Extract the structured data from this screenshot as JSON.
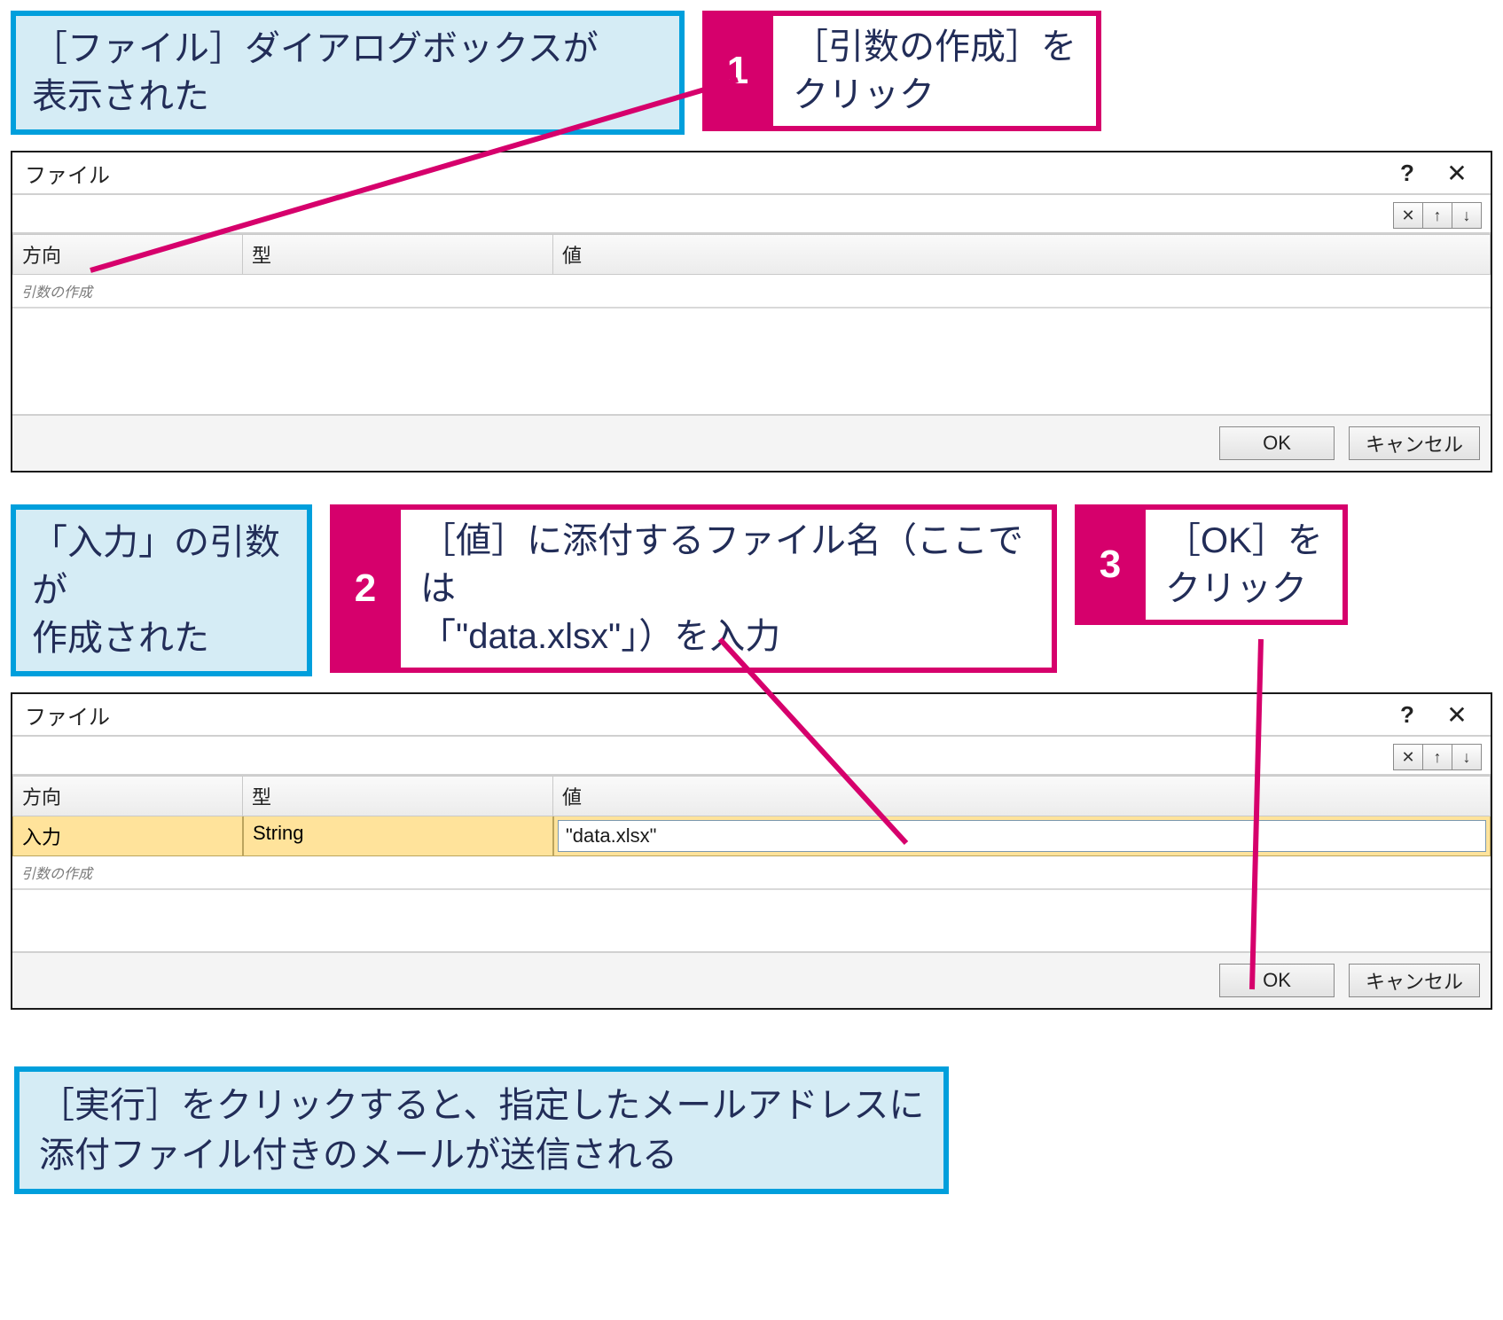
{
  "callouts": {
    "intro1": "［ファイル］ダイアログボックスが\n表示された",
    "step1_num": "1",
    "step1_text": "［引数の作成］を\nクリック",
    "intro2": "「入力」の引数が\n作成された",
    "step2_num": "2",
    "step2_text": "［値］に添付するファイル名（ここでは\n「\"data.xlsx\"」）を入力",
    "step3_num": "3",
    "step3_text": "［OK］を\nクリック",
    "final": "［実行］をクリックすると、指定したメールアドレスに\n添付ファイル付きのメールが送信される"
  },
  "dialog1": {
    "title": "ファイル",
    "columns": {
      "direction": "方向",
      "type": "型",
      "value": "値"
    },
    "placeholder_row": "引数の作成",
    "ok": "OK",
    "cancel": "キャンセル"
  },
  "dialog2": {
    "title": "ファイル",
    "columns": {
      "direction": "方向",
      "type": "型",
      "value": "値"
    },
    "row": {
      "direction": "入力",
      "type": "String",
      "value": "\"data.xlsx\""
    },
    "placeholder_row": "引数の作成",
    "ok": "OK",
    "cancel": "キャンセル"
  },
  "icons": {
    "delete": "✕",
    "up": "↑",
    "down": "↓",
    "help": "?",
    "close": "✕"
  }
}
